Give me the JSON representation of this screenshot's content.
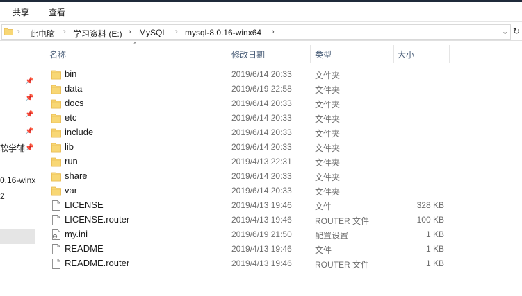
{
  "ribbon": {
    "tabs": [
      "共享",
      "查看"
    ]
  },
  "address": {
    "crumbs": [
      "此电脑",
      "学习资料 (E:)",
      "MySQL",
      "mysql-8.0.16-winx64"
    ],
    "separator": "›",
    "dropdown_glyph": "⌄",
    "refresh_glyph": "↻"
  },
  "navpane": {
    "partial_items": [
      "软学辅",
      "0.16-winx",
      "2"
    ]
  },
  "columns": {
    "name": "名称",
    "date": "修改日期",
    "type": "类型",
    "size": "大小"
  },
  "files": [
    {
      "name": "bin",
      "date": "2019/6/14 20:33",
      "type": "文件夹",
      "size": "",
      "icon": "folder-icon"
    },
    {
      "name": "data",
      "date": "2019/6/19 22:58",
      "type": "文件夹",
      "size": "",
      "icon": "folder-icon"
    },
    {
      "name": "docs",
      "date": "2019/6/14 20:33",
      "type": "文件夹",
      "size": "",
      "icon": "folder-icon"
    },
    {
      "name": "etc",
      "date": "2019/6/14 20:33",
      "type": "文件夹",
      "size": "",
      "icon": "folder-icon"
    },
    {
      "name": "include",
      "date": "2019/6/14 20:33",
      "type": "文件夹",
      "size": "",
      "icon": "folder-icon"
    },
    {
      "name": "lib",
      "date": "2019/6/14 20:33",
      "type": "文件夹",
      "size": "",
      "icon": "folder-icon"
    },
    {
      "name": "run",
      "date": "2019/4/13 22:31",
      "type": "文件夹",
      "size": "",
      "icon": "folder-icon"
    },
    {
      "name": "share",
      "date": "2019/6/14 20:33",
      "type": "文件夹",
      "size": "",
      "icon": "folder-icon"
    },
    {
      "name": "var",
      "date": "2019/6/14 20:33",
      "type": "文件夹",
      "size": "",
      "icon": "folder-icon"
    },
    {
      "name": "LICENSE",
      "date": "2019/4/13 19:46",
      "type": "文件",
      "size": "328 KB",
      "icon": "file-icon"
    },
    {
      "name": "LICENSE.router",
      "date": "2019/4/13 19:46",
      "type": "ROUTER 文件",
      "size": "100 KB",
      "icon": "file-icon"
    },
    {
      "name": "my.ini",
      "date": "2019/6/19 21:50",
      "type": "配置设置",
      "size": "1 KB",
      "icon": "settings-file-icon"
    },
    {
      "name": "README",
      "date": "2019/4/13 19:46",
      "type": "文件",
      "size": "1 KB",
      "icon": "file-icon"
    },
    {
      "name": "README.router",
      "date": "2019/4/13 19:46",
      "type": "ROUTER 文件",
      "size": "1 KB",
      "icon": "file-icon"
    }
  ],
  "colors": {
    "folder": "#f8d775",
    "folder_dark": "#e8b84a",
    "header_text": "#4c607a",
    "meta_text": "#6d6d6d"
  }
}
